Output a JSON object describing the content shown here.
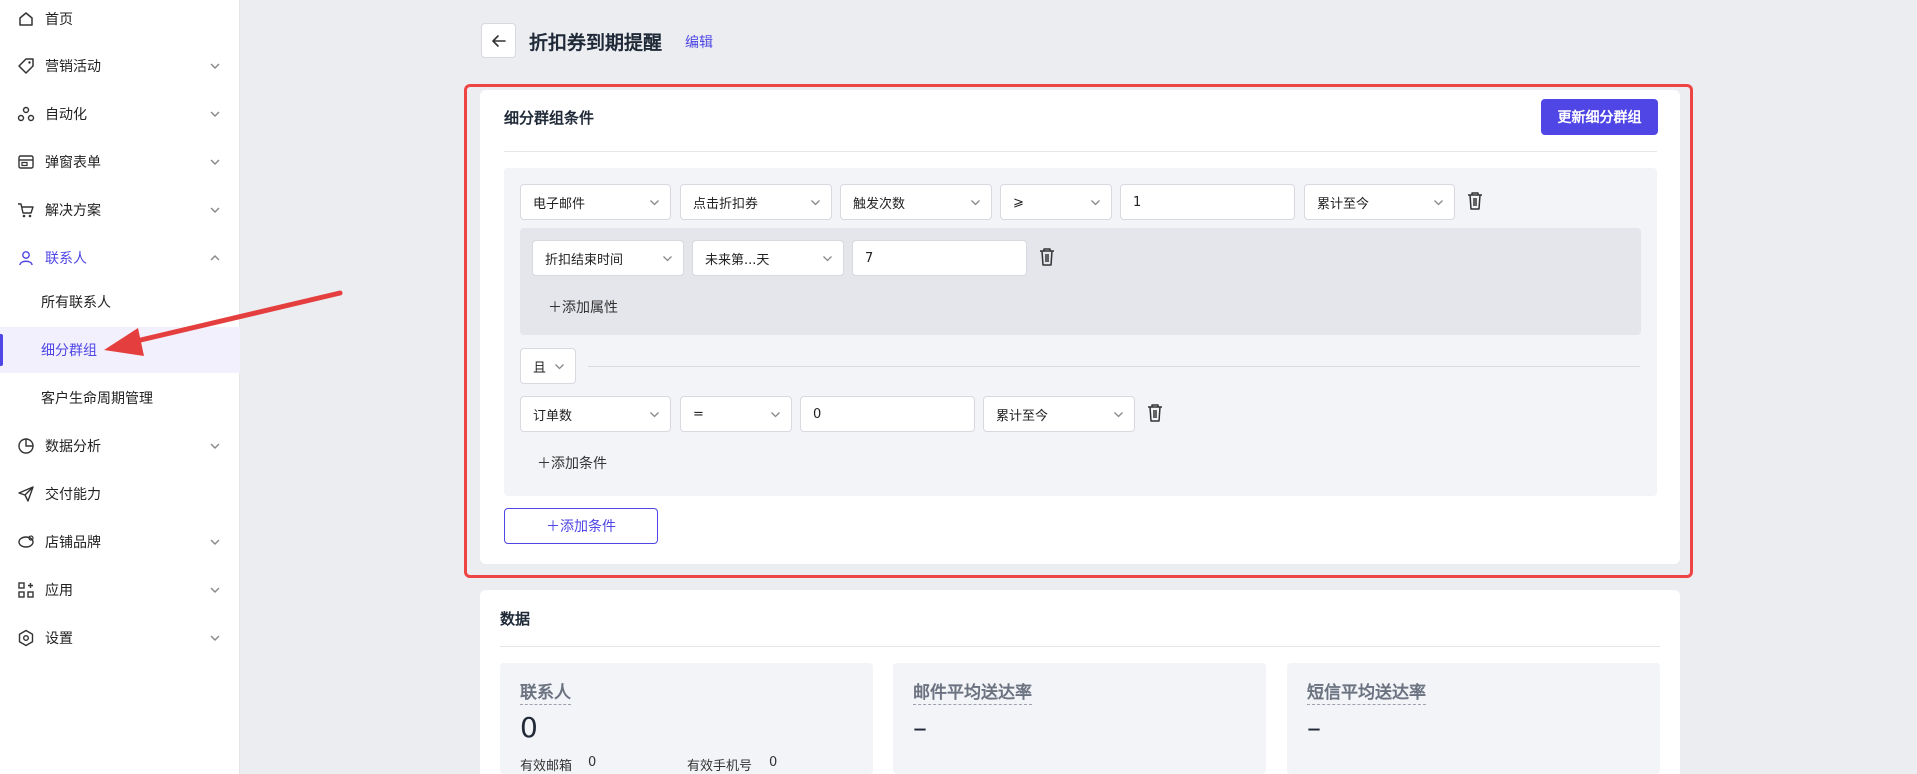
{
  "sidebar": {
    "items": [
      {
        "label": "首页",
        "icon": "home-icon"
      },
      {
        "label": "营销活动",
        "icon": "tag-icon"
      },
      {
        "label": "自动化",
        "icon": "automation-icon"
      },
      {
        "label": "弹窗表单",
        "icon": "form-icon"
      },
      {
        "label": "解决方案",
        "icon": "cart-icon"
      },
      {
        "label": "联系人",
        "icon": "user-icon"
      },
      {
        "label": "数据分析",
        "icon": "pie-chart-icon"
      },
      {
        "label": "交付能力",
        "icon": "send-icon"
      },
      {
        "label": "店铺品牌",
        "icon": "store-icon"
      },
      {
        "label": "应用",
        "icon": "apps-icon"
      },
      {
        "label": "设置",
        "icon": "settings-icon"
      }
    ],
    "contacts_sub": [
      "所有联系人",
      "细分群组",
      "客户生命周期管理"
    ]
  },
  "header": {
    "title": "折扣券到期提醒",
    "edit": "编辑"
  },
  "segment": {
    "title": "细分群组条件",
    "update_button": "更新细分群组",
    "condition1": {
      "channel": "电子邮件",
      "event": "点击折扣券",
      "metric": "触发次数",
      "operator": "⩾",
      "value": "1",
      "period": "累计至今"
    },
    "attribute": {
      "field": "折扣结束时间",
      "operator": "未来第...天",
      "value": "7",
      "add_label": "＋添加属性"
    },
    "logic": "且",
    "condition2": {
      "field": "订单数",
      "operator": "=",
      "value": "0",
      "period": "累计至今"
    },
    "add_condition_inner": "＋添加条件",
    "add_condition_button": "＋添加条件"
  },
  "data_section": {
    "title": "数据",
    "stats": [
      {
        "label": "联系人",
        "value": "0",
        "sub": [
          {
            "label": "有效邮箱",
            "value": "0"
          },
          {
            "label": "有效手机号",
            "value": "0"
          }
        ]
      },
      {
        "label": "邮件平均送达率",
        "value": "–"
      },
      {
        "label": "短信平均送达率",
        "value": "–"
      }
    ]
  },
  "colors": {
    "accent": "#4f46e5",
    "highlight": "#ef4444",
    "annotation_arrow": "#e53e3e"
  }
}
